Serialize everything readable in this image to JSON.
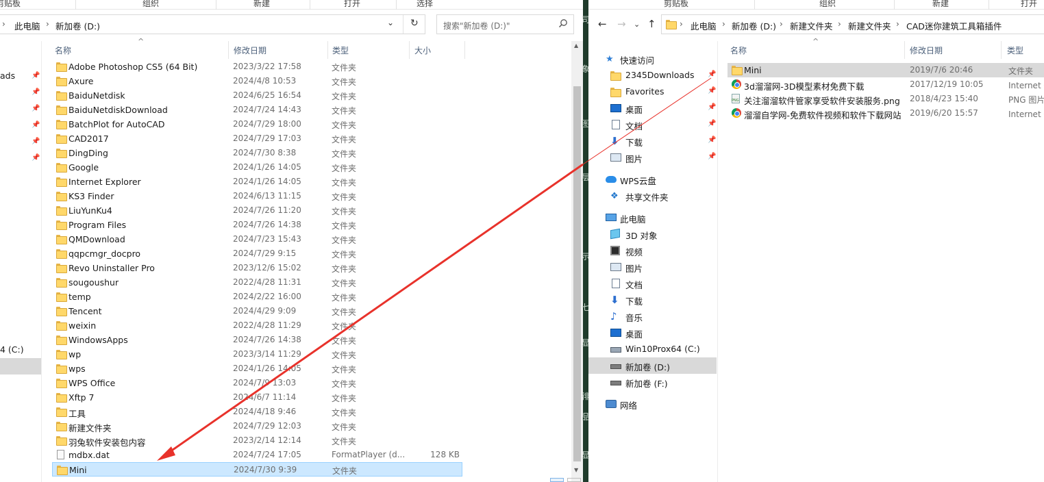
{
  "left": {
    "ribbon": {
      "group1": "剪贴板",
      "group2": "组织",
      "group3": "新建",
      "group4": "打开",
      "group5": "选择"
    },
    "breadcrumb": [
      "此电脑",
      "新加卷 (D:)"
    ],
    "search_placeholder": "搜索\"新加卷 (D:)\"",
    "columns": {
      "name": "名称",
      "date": "修改日期",
      "type": "类型",
      "size": "大小"
    },
    "nav_partial": {
      "downloads": "ads",
      "drive_c": "4 (C:)"
    },
    "files": [
      {
        "name": "Adobe Photoshop CS5 (64 Bit)",
        "date": "2023/3/22 17:58",
        "type": "文件夹",
        "size": "",
        "icon": "folder"
      },
      {
        "name": "Axure",
        "date": "2024/4/8 10:53",
        "type": "文件夹",
        "size": "",
        "icon": "folder"
      },
      {
        "name": "BaiduNetdisk",
        "date": "2024/6/25 16:54",
        "type": "文件夹",
        "size": "",
        "icon": "folder"
      },
      {
        "name": "BaiduNetdiskDownload",
        "date": "2024/7/24 14:43",
        "type": "文件夹",
        "size": "",
        "icon": "folder"
      },
      {
        "name": "BatchPlot for AutoCAD",
        "date": "2024/7/29 18:00",
        "type": "文件夹",
        "size": "",
        "icon": "folder"
      },
      {
        "name": "CAD2017",
        "date": "2024/7/29 17:03",
        "type": "文件夹",
        "size": "",
        "icon": "folder"
      },
      {
        "name": "DingDing",
        "date": "2024/7/30 8:38",
        "type": "文件夹",
        "size": "",
        "icon": "folder"
      },
      {
        "name": "Google",
        "date": "2024/1/26 14:05",
        "type": "文件夹",
        "size": "",
        "icon": "folder"
      },
      {
        "name": "Internet Explorer",
        "date": "2024/1/26 14:05",
        "type": "文件夹",
        "size": "",
        "icon": "folder"
      },
      {
        "name": "KS3 Finder",
        "date": "2024/6/13 11:15",
        "type": "文件夹",
        "size": "",
        "icon": "folder"
      },
      {
        "name": "LiuYunKu4",
        "date": "2024/7/26 11:20",
        "type": "文件夹",
        "size": "",
        "icon": "folder"
      },
      {
        "name": "Program Files",
        "date": "2024/7/26 14:38",
        "type": "文件夹",
        "size": "",
        "icon": "folder"
      },
      {
        "name": "QMDownload",
        "date": "2024/7/23 15:43",
        "type": "文件夹",
        "size": "",
        "icon": "folder"
      },
      {
        "name": "qqpcmgr_docpro",
        "date": "2024/7/29 9:15",
        "type": "文件夹",
        "size": "",
        "icon": "folder"
      },
      {
        "name": "Revo Uninstaller Pro",
        "date": "2023/12/6 15:02",
        "type": "文件夹",
        "size": "",
        "icon": "folder"
      },
      {
        "name": "sougoushur",
        "date": "2022/4/28 11:31",
        "type": "文件夹",
        "size": "",
        "icon": "folder"
      },
      {
        "name": "temp",
        "date": "2024/2/22 16:00",
        "type": "文件夹",
        "size": "",
        "icon": "folder"
      },
      {
        "name": "Tencent",
        "date": "2024/4/29 9:09",
        "type": "文件夹",
        "size": "",
        "icon": "folder"
      },
      {
        "name": "weixin",
        "date": "2022/4/28 11:29",
        "type": "文件夹",
        "size": "",
        "icon": "folder"
      },
      {
        "name": "WindowsApps",
        "date": "2024/7/26 14:38",
        "type": "文件夹",
        "size": "",
        "icon": "folder"
      },
      {
        "name": "wp",
        "date": "2023/3/14 11:29",
        "type": "文件夹",
        "size": "",
        "icon": "folder"
      },
      {
        "name": "wps",
        "date": "2024/1/26 14:05",
        "type": "文件夹",
        "size": "",
        "icon": "folder"
      },
      {
        "name": "WPS Office",
        "date": "2024/7/9 13:03",
        "type": "文件夹",
        "size": "",
        "icon": "folder"
      },
      {
        "name": "Xftp 7",
        "date": "2024/6/7 11:14",
        "type": "文件夹",
        "size": "",
        "icon": "folder"
      },
      {
        "name": "工具",
        "date": "2024/4/18 9:46",
        "type": "文件夹",
        "size": "",
        "icon": "folder"
      },
      {
        "name": "新建文件夹",
        "date": "2024/7/29 12:03",
        "type": "文件夹",
        "size": "",
        "icon": "folder"
      },
      {
        "name": "羽兔软件安装包内容",
        "date": "2023/2/14 12:14",
        "type": "文件夹",
        "size": "",
        "icon": "folder"
      },
      {
        "name": "mdbx.dat",
        "date": "2024/7/24 17:05",
        "type": "FormatPlayer (d...",
        "size": "128 KB",
        "icon": "file"
      },
      {
        "name": "Mini",
        "date": "2024/7/30 9:39",
        "type": "文件夹",
        "size": "",
        "icon": "folder"
      }
    ]
  },
  "right": {
    "ribbon": {
      "group1": "剪贴板",
      "group2": "组织",
      "group3": "新建",
      "group4": "打开"
    },
    "breadcrumb": [
      "此电脑",
      "新加卷 (D:)",
      "新建文件夹",
      "新建文件夹",
      "CAD迷你建筑工具箱插件"
    ],
    "columns": {
      "name": "名称",
      "date": "修改日期",
      "type": "类型"
    },
    "nav": [
      {
        "label": "快速访问",
        "icon": "star",
        "level": 0,
        "pinned": false
      },
      {
        "label": "2345Downloads",
        "icon": "folder",
        "level": 1,
        "pinned": true
      },
      {
        "label": "Favorites",
        "icon": "folder",
        "level": 1,
        "pinned": true
      },
      {
        "label": "桌面",
        "icon": "desktop",
        "level": 1,
        "pinned": true
      },
      {
        "label": "文档",
        "icon": "doc",
        "level": 1,
        "pinned": true
      },
      {
        "label": "下载",
        "icon": "down",
        "level": 1,
        "pinned": true
      },
      {
        "label": "图片",
        "icon": "pic",
        "level": 1,
        "pinned": true
      },
      {
        "label": "WPS云盘",
        "icon": "cloud",
        "level": 0,
        "pinned": false
      },
      {
        "label": "共享文件夹",
        "icon": "share",
        "level": 1,
        "pinned": false
      },
      {
        "label": "此电脑",
        "icon": "pc",
        "level": 0,
        "pinned": false
      },
      {
        "label": "3D 对象",
        "icon": "3d",
        "level": 1,
        "pinned": false
      },
      {
        "label": "视频",
        "icon": "video",
        "level": 1,
        "pinned": false
      },
      {
        "label": "图片",
        "icon": "pic",
        "level": 1,
        "pinned": false
      },
      {
        "label": "文档",
        "icon": "doc",
        "level": 1,
        "pinned": false
      },
      {
        "label": "下载",
        "icon": "down",
        "level": 1,
        "pinned": false
      },
      {
        "label": "音乐",
        "icon": "music",
        "level": 1,
        "pinned": false
      },
      {
        "label": "桌面",
        "icon": "desktop",
        "level": 1,
        "pinned": false
      },
      {
        "label": "Win10Prox64 (C:)",
        "icon": "windrive",
        "level": 1,
        "pinned": false
      },
      {
        "label": "新加卷 (D:)",
        "icon": "drive",
        "level": 1,
        "pinned": false
      },
      {
        "label": "新加卷 (F:)",
        "icon": "drive",
        "level": 1,
        "pinned": false
      },
      {
        "label": "网络",
        "icon": "net",
        "level": 0,
        "pinned": false
      }
    ],
    "files": [
      {
        "name": "Mini",
        "date": "2019/7/6 20:46",
        "type": "文件夹",
        "icon": "folder"
      },
      {
        "name": "3d溜溜网-3D模型素材免费下载",
        "date": "2017/12/19 10:05",
        "type": "Internet 快",
        "icon": "chrome"
      },
      {
        "name": "关注溜溜软件管家享受软件安装服务.png",
        "date": "2018/4/23 15:40",
        "type": "PNG 图片",
        "icon": "png"
      },
      {
        "name": "溜溜自学网-免费软件视频和软件下载网站",
        "date": "2019/6/20 15:57",
        "type": "Internet 快",
        "icon": "chrome"
      }
    ]
  },
  "gap_glyphs": [
    "司",
    "象",
    "图",
    "层",
    "示",
    "七",
    "显",
    "徘",
    "品",
    "显"
  ],
  "colors": {
    "arrow": "#e8322b",
    "selection_bg": "#cce8ff",
    "selection_border": "#99d1ff",
    "gray_select": "#d9d9d9"
  }
}
